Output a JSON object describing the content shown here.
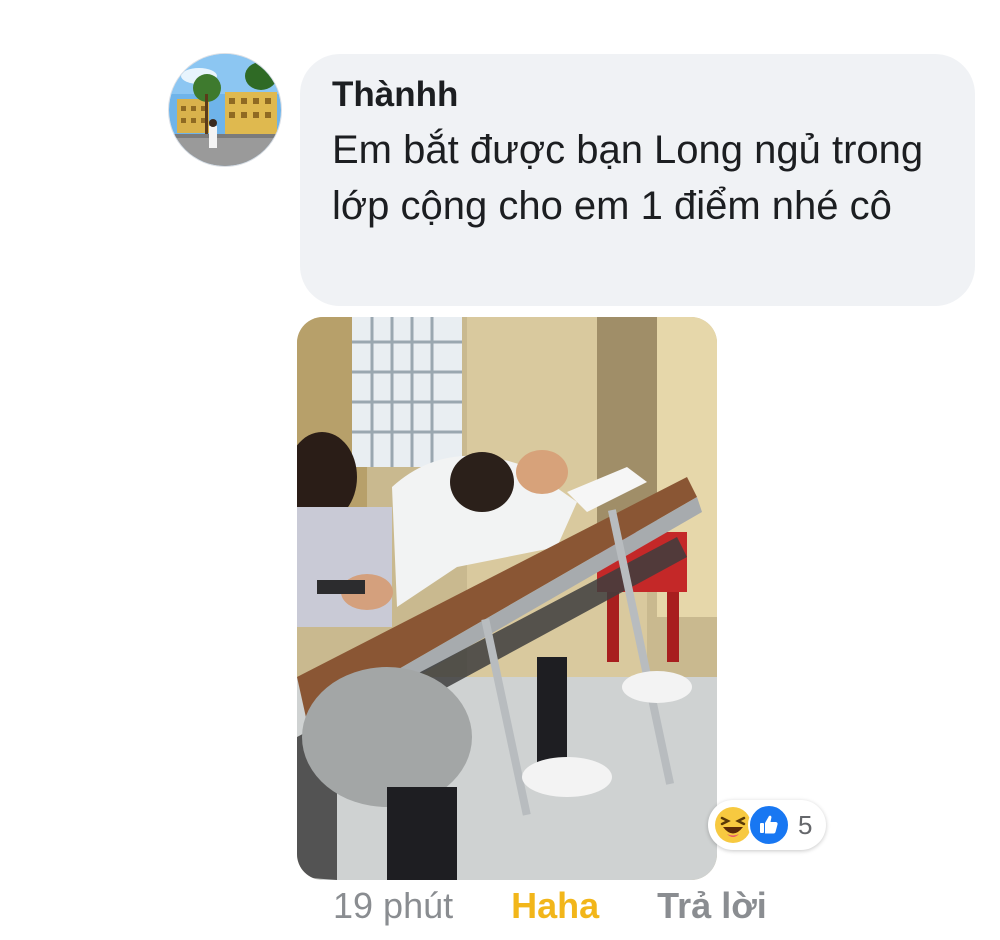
{
  "comment": {
    "author": "Thànhh",
    "text": "Em bắt được bạn Long ngủ trong lớp cộng cho em 1 điểm nhé cô",
    "avatar_icon": "school-building-avatar",
    "photo_description_icon": "classroom-photo"
  },
  "reactions": {
    "icons": [
      "haha-icon",
      "like-icon"
    ],
    "count": "5"
  },
  "actions": {
    "time": "19 phút",
    "reaction_label": "Haha",
    "reply_label": "Trả lời"
  },
  "colors": {
    "bubble": "#f0f2f5",
    "haha_accent": "#f2b61a",
    "like_blue": "#1877f2",
    "muted_text": "#8a8d91"
  }
}
